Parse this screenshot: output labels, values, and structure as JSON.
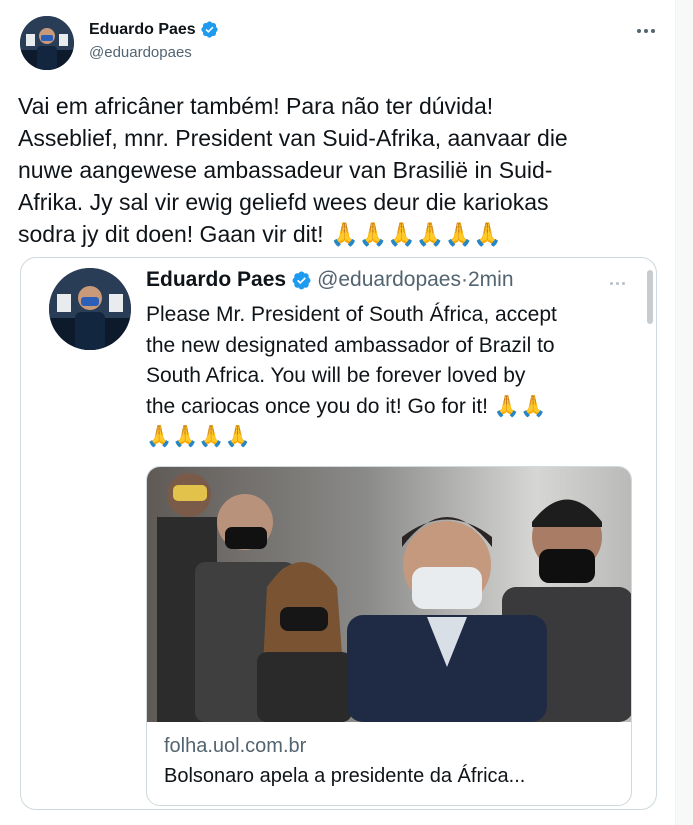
{
  "author": {
    "name": "Eduardo Paes",
    "handle": "@eduardopaes"
  },
  "tweet": {
    "text": "Vai em africâner também!  Para não ter dúvida!\nAsseblief, mnr. President van Suid-Afrika, aanvaar die\nnuwe aangewese ambassadeur van Brasilië in Suid-\nAfrika.  Jy sal vir ewig geliefd wees deur die kariokas\nsodra jy dit doen!  Gaan vir dit!  🙏🙏🙏🙏🙏🙏"
  },
  "quoted": {
    "name": "Eduardo Paes",
    "handle": "@eduardopaes",
    "separator": "·",
    "time": "2min",
    "text": "Please Mr. President of South África, accept\nthe new designated ambassador of Brazil to\nSouth Africa.  You will be forever loved by\nthe cariocas once you do it! Go for it!  🙏🙏\n🙏🙏🙏🙏",
    "link": {
      "domain": "folha.uol.com.br",
      "title": "Bolsonaro apela a presidente da África..."
    }
  },
  "colors": {
    "verified": "#1d9bf0",
    "secondary_text": "#536471",
    "border": "#cfd9de"
  },
  "icons": {
    "verified": "verified-badge-icon",
    "more": "more-options-icon"
  }
}
